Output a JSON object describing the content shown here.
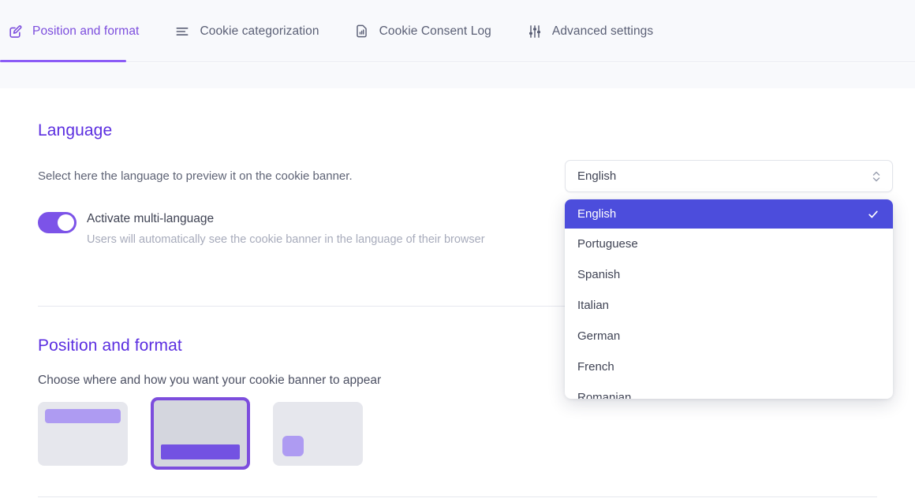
{
  "tabs": [
    {
      "label": "Position and format",
      "icon": "edit-square-icon",
      "active": true
    },
    {
      "label": "Cookie categorization",
      "icon": "list-lines-icon",
      "active": false
    },
    {
      "label": "Cookie Consent  Log",
      "icon": "document-chart-icon",
      "active": false
    },
    {
      "label": "Advanced settings",
      "icon": "sliders-icon",
      "active": false
    }
  ],
  "language": {
    "title": "Language",
    "description": "Select here the language to preview it on the cookie banner.",
    "toggle": {
      "label": "Activate multi-language",
      "sublabel": "Users will automatically see the cookie banner in the language of their browser",
      "state": "on"
    },
    "select": {
      "value": "English",
      "icon": "chevron-up-down-icon",
      "options": [
        {
          "label": "English",
          "selected": true
        },
        {
          "label": "Portuguese",
          "selected": false
        },
        {
          "label": "Spanish",
          "selected": false
        },
        {
          "label": "Italian",
          "selected": false
        },
        {
          "label": "German",
          "selected": false
        },
        {
          "label": "French",
          "selected": false
        },
        {
          "label": "Romanian",
          "selected": false
        }
      ]
    }
  },
  "position_format": {
    "title": "Position and format",
    "description": "Choose where and how you want your cookie banner to appear",
    "options": [
      {
        "name": "top-banner",
        "selected": false
      },
      {
        "name": "bottom-banner",
        "selected": true
      },
      {
        "name": "corner-box",
        "selected": false
      }
    ]
  },
  "colors": {
    "accent_purple": "#7c4ddd",
    "heading_purple": "#5b2ee0",
    "highlight_blue": "#4c4ddc",
    "toggle_on": "#7c53e8",
    "card_bg": "#e6e7ed",
    "bar_light": "#ae9bf2",
    "bar_dark": "#7352e2",
    "tabbar_bg": "#f8f9fc",
    "divider": "#e6e8ee"
  }
}
